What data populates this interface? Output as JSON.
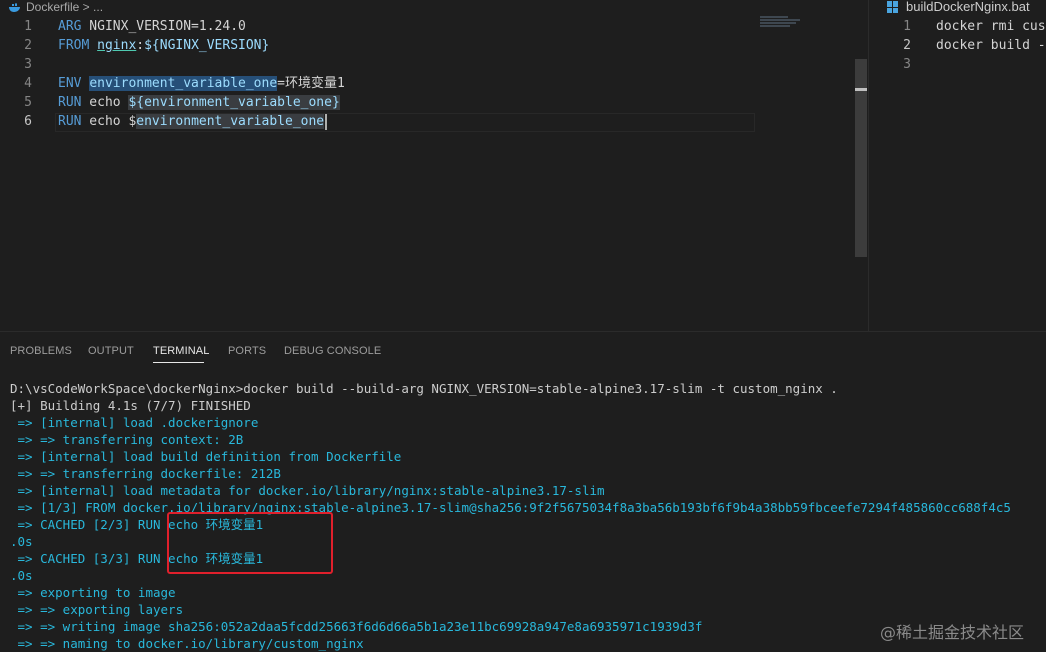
{
  "left_editor": {
    "breadcrumb": "Dockerfile > ...",
    "line_numbers": [
      "1",
      "2",
      "3",
      "4",
      "5",
      "6"
    ],
    "line1": {
      "kw": "ARG",
      "rest": " NGINX_VERSION=1.24.0"
    },
    "line2": {
      "kw": "FROM",
      "sp": " ",
      "img": "nginx",
      "colon": ":",
      "var": "${NGINX_VERSION}"
    },
    "line4": {
      "kw": "ENV",
      "sp": " ",
      "name": "environment_variable_one",
      "eq": "=",
      "val": "环境变量1"
    },
    "line5": {
      "kw": "RUN",
      "cmd": " echo ",
      "var": "${environment_variable_one}"
    },
    "line6": {
      "kw": "RUN",
      "cmd": " echo ",
      "dollar": "$",
      "name": "environment_variable_one"
    }
  },
  "right_editor": {
    "tab_title": "buildDockerNginx.bat",
    "line_numbers": [
      "1",
      "2",
      "3"
    ],
    "lines": [
      "docker rmi cust",
      "docker build -",
      ""
    ]
  },
  "panel": {
    "tabs": {
      "problems": "PROBLEMS",
      "output": "OUTPUT",
      "terminal": "TERMINAL",
      "ports": "PORTS",
      "debug_console": "DEBUG CONSOLE"
    },
    "active_tab": "TERMINAL",
    "terminal_lines": [
      "D:\\vsCodeWorkSpace\\dockerNginx>docker build --build-arg NGINX_VERSION=stable-alpine3.17-slim -t custom_nginx .",
      "[+] Building 4.1s (7/7) FINISHED",
      " => [internal] load .dockerignore",
      " => => transferring context: 2B",
      " => [internal] load build definition from Dockerfile",
      " => => transferring dockerfile: 212B",
      " => [internal] load metadata for docker.io/library/nginx:stable-alpine3.17-slim",
      " => [1/3] FROM docker.io/library/nginx:stable-alpine3.17-slim@sha256:9f2f5675034f8a3ba56b193bf6f9b4a38bb59fbceefe7294f485860cc688f4c5",
      " => CACHED [2/3] RUN echo 环境变量1",
      ".0s",
      " => CACHED [3/3] RUN echo 环境变量1",
      ".0s",
      " => exporting to image",
      " => => exporting layers",
      " => => writing image sha256:052a2daa5fcdd25663f6d6d66a5b1a23e11bc69928a947e8a6935971c1939d3f",
      " => => naming to docker.io/library/custom_nginx"
    ]
  },
  "watermark": "@稀土掘金技术社区",
  "colors": {
    "accent": "#3794ff",
    "keyword": "#569cd6",
    "variable": "#9cdcfe",
    "annotation_box": "#e0202c"
  }
}
